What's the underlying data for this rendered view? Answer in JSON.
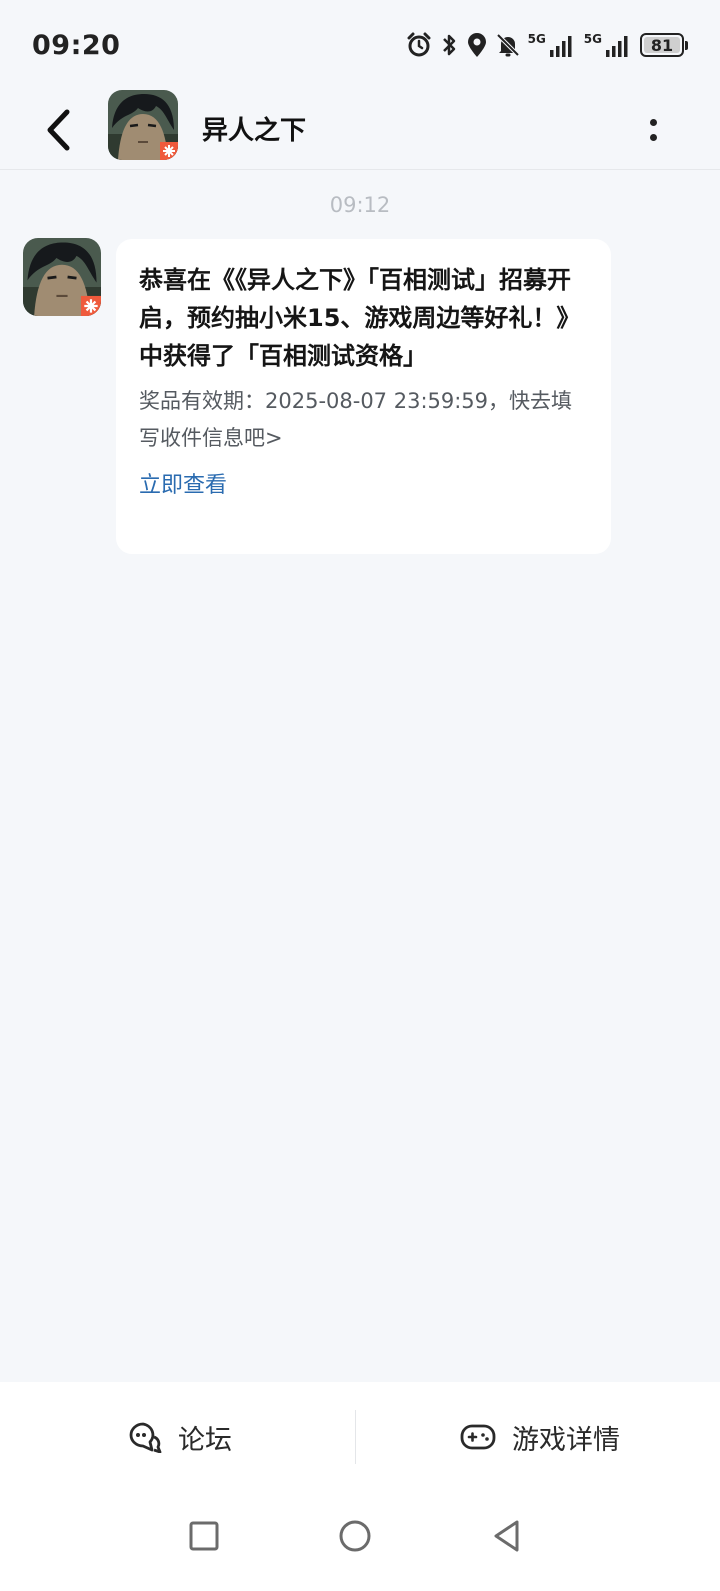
{
  "status_bar": {
    "time": "09:20",
    "icons": [
      "alarm-icon",
      "bluetooth-icon",
      "location-icon",
      "mute-icon",
      "signal-5g-icon",
      "signal-5g-icon"
    ],
    "network_1": "5G",
    "network_2": "5G",
    "battery": "81"
  },
  "header": {
    "title": "异人之下",
    "back_icon": "back-arrow-icon",
    "more_icon": "more-vertical-icon"
  },
  "chat": {
    "timestamp": "09:12",
    "message": {
      "title": "恭喜在《《异人之下》「百相测试」招募开启，预约抽小米15、游戏周边等好礼！》中获得了「百相测试资格」",
      "subtitle": "奖品有效期：2025-08-07 23:59:59，快去填写收件信息吧>",
      "link": "立即查看"
    }
  },
  "bottom_bar": {
    "tabs": [
      {
        "label": "论坛",
        "icon": "forum-chat-icon"
      },
      {
        "label": "游戏详情",
        "icon": "gamepad-icon"
      }
    ]
  },
  "nav_bar": {
    "buttons": [
      "recents-square-icon",
      "home-circle-icon",
      "back-triangle-icon"
    ]
  },
  "colors": {
    "background": "#f5f7fa",
    "bubble": "#ffffff",
    "link": "#2a6bb0",
    "timestamp": "#b8bcc2"
  }
}
